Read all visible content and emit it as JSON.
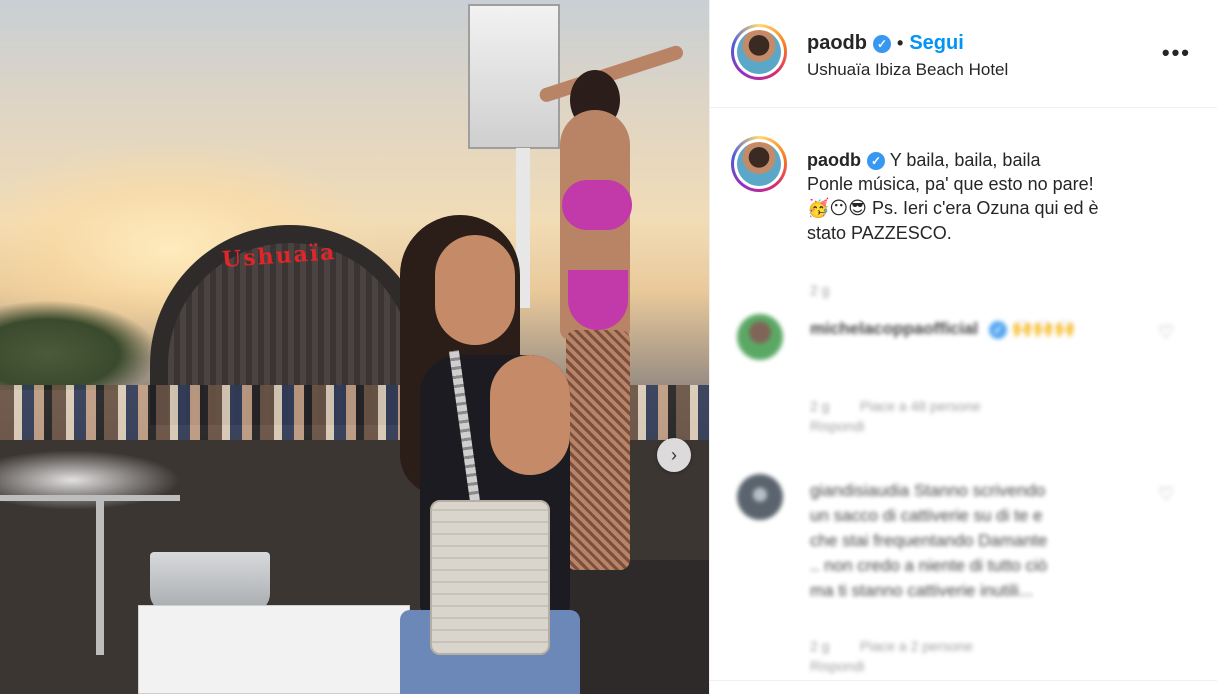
{
  "post": {
    "username": "paodb",
    "follow_label": "Segui",
    "separator": "•",
    "location": "Ushuaïa Ibiza Beach Hotel",
    "more_label": "•••",
    "stage_sign": "Ushuaïa"
  },
  "caption": {
    "username": "paodb",
    "line1": "Y baila, baila, baila",
    "line2": "Ponle música, pa' que esto no pare!",
    "emojis": "🥳😶😎",
    "line3": " Ps. Ieri c'era Ozuna qui ed è",
    "line4": "stato PAZZESCO.",
    "time": "2 g"
  },
  "comments": [
    {
      "username": "michelacoppaofficial",
      "text": "🙌🙌🙌",
      "time": "2 g",
      "likes": "Piace a 48 persone",
      "reply": "Rispondi",
      "avatar_color": "#3f9a4b"
    },
    {
      "username": "giandisiaudia",
      "text": "Stanno scrivendo un sacco di cattiverie su di te e che stai frequentando Damante .. non credo a niente di tutto ciò ma ti stanno cattiverie inutili...",
      "lines": [
        "giandisiaudia Stanno scrivendo",
        "un sacco di cattiverie su di te e",
        "che stai frequentando Damante",
        ".. non credo a niente di tutto ciò",
        "ma ti stanno cattiverie inutili..."
      ],
      "time": "2 g",
      "likes": "Piace a 2 persone",
      "reply": "Rispondi",
      "avatar_color": "#3f4a55"
    }
  ],
  "icons": {
    "verified": "✓",
    "next": "›",
    "heart": "♡"
  },
  "colors": {
    "follow": "#0095f6",
    "verified": "#3897f0",
    "meta": "#8e8e8e"
  }
}
